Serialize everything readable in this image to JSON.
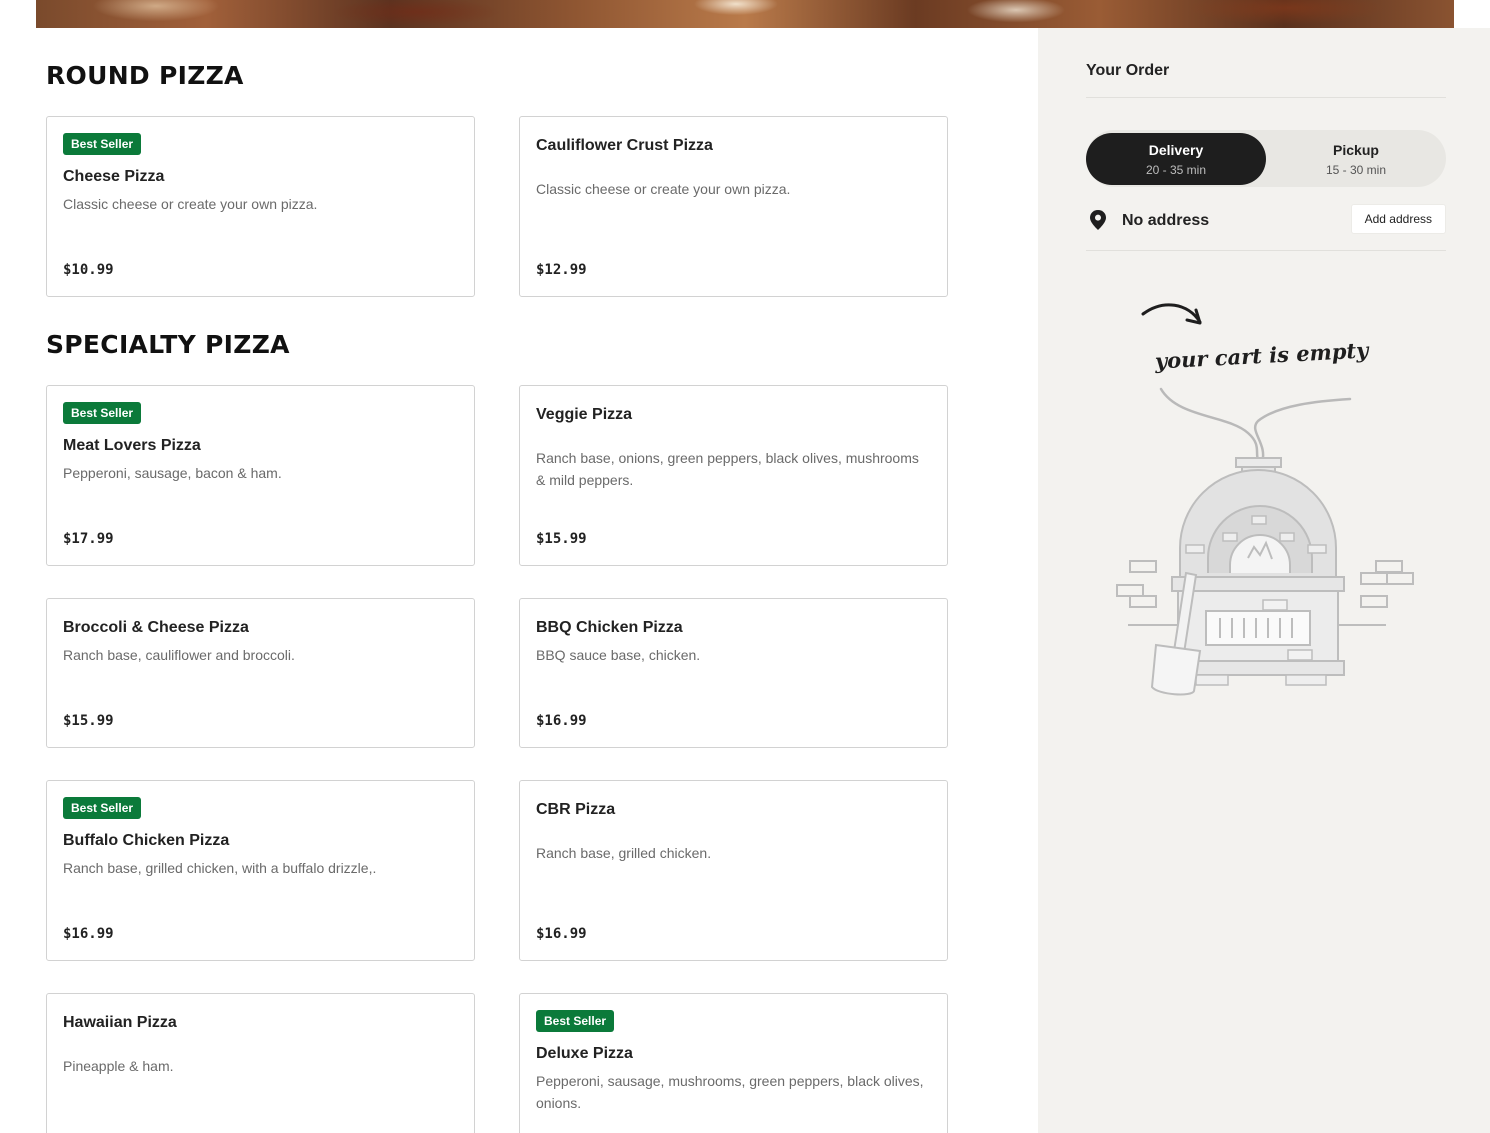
{
  "sections": [
    {
      "title": "ROUND PIZZA",
      "items": [
        {
          "badge": "Best Seller",
          "name": "Cheese Pizza",
          "description": "Classic cheese or create your own pizza.",
          "price": "$10.99"
        },
        {
          "badge": "",
          "name": "Cauliflower Crust Pizza",
          "description": "Classic cheese or create your own pizza.",
          "price": "$12.99"
        }
      ]
    },
    {
      "title": "SPECIALTY PIZZA",
      "items": [
        {
          "badge": "Best Seller",
          "name": "Meat Lovers Pizza",
          "description": "Pepperoni, sausage, bacon & ham.",
          "price": "$17.99"
        },
        {
          "badge": "",
          "name": "Veggie Pizza",
          "description": "Ranch base, onions, green peppers, black olives, mushrooms & mild peppers.",
          "price": "$15.99"
        },
        {
          "badge": "",
          "name": "Broccoli & Cheese Pizza",
          "description": "Ranch base, cauliflower and broccoli.",
          "price": "$15.99"
        },
        {
          "badge": "",
          "name": "BBQ Chicken Pizza",
          "description": "BBQ sauce base, chicken.",
          "price": "$16.99"
        },
        {
          "badge": "Best Seller",
          "name": "Buffalo Chicken Pizza",
          "description": "Ranch base, grilled chicken, with a buffalo drizzle,.",
          "price": "$16.99"
        },
        {
          "badge": "",
          "name": "CBR Pizza",
          "description": "Ranch base, grilled chicken.",
          "price": "$16.99"
        },
        {
          "badge": "",
          "name": "Hawaiian Pizza",
          "description": "Pineapple & ham.",
          "price": ""
        },
        {
          "badge": "Best Seller",
          "name": "Deluxe Pizza",
          "description": "Pepperoni, sausage, mushrooms, green peppers, black olives, onions.",
          "price": ""
        }
      ]
    }
  ],
  "order": {
    "title": "Your Order",
    "delivery": {
      "label": "Delivery",
      "time": "20 - 35 min",
      "selected": true
    },
    "pickup": {
      "label": "Pickup",
      "time": "15 - 30 min",
      "selected": false
    },
    "address": "No address",
    "add_address_label": "Add address",
    "empty_message": "your cart is empty"
  },
  "icons": {
    "address": "map-pin-icon",
    "empty_illustration": "pizza-oven-illustration",
    "arrow": "curved-arrow-icon"
  },
  "colors": {
    "badge": "#0b7a3a",
    "toggle_active": "#1e1e1e",
    "sidebar_bg": "#f3f2ef"
  }
}
